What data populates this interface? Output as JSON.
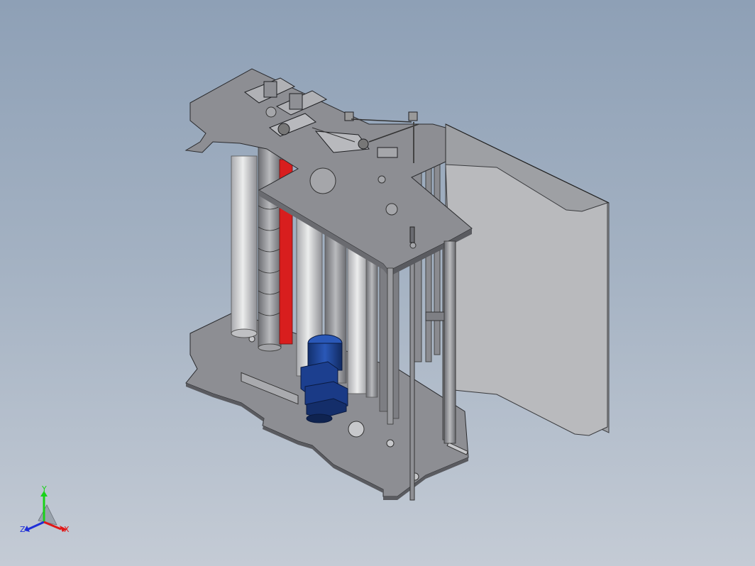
{
  "viewport": {
    "background_top": "#8ea0b6",
    "background_bottom": "#c4cbd5"
  },
  "model": {
    "plate_color": "#8d8e93",
    "roller_color": "#c9cacd",
    "red_part_color": "#d81e1e",
    "motor_color": "#1c3f8f",
    "panel_color": "#b4b5b8"
  },
  "triad": {
    "y_label": "Y",
    "z_label": "Z",
    "x_label": "X",
    "y_color": "#19d219",
    "z_color": "#1f2fd8",
    "x_color": "#e01818"
  }
}
